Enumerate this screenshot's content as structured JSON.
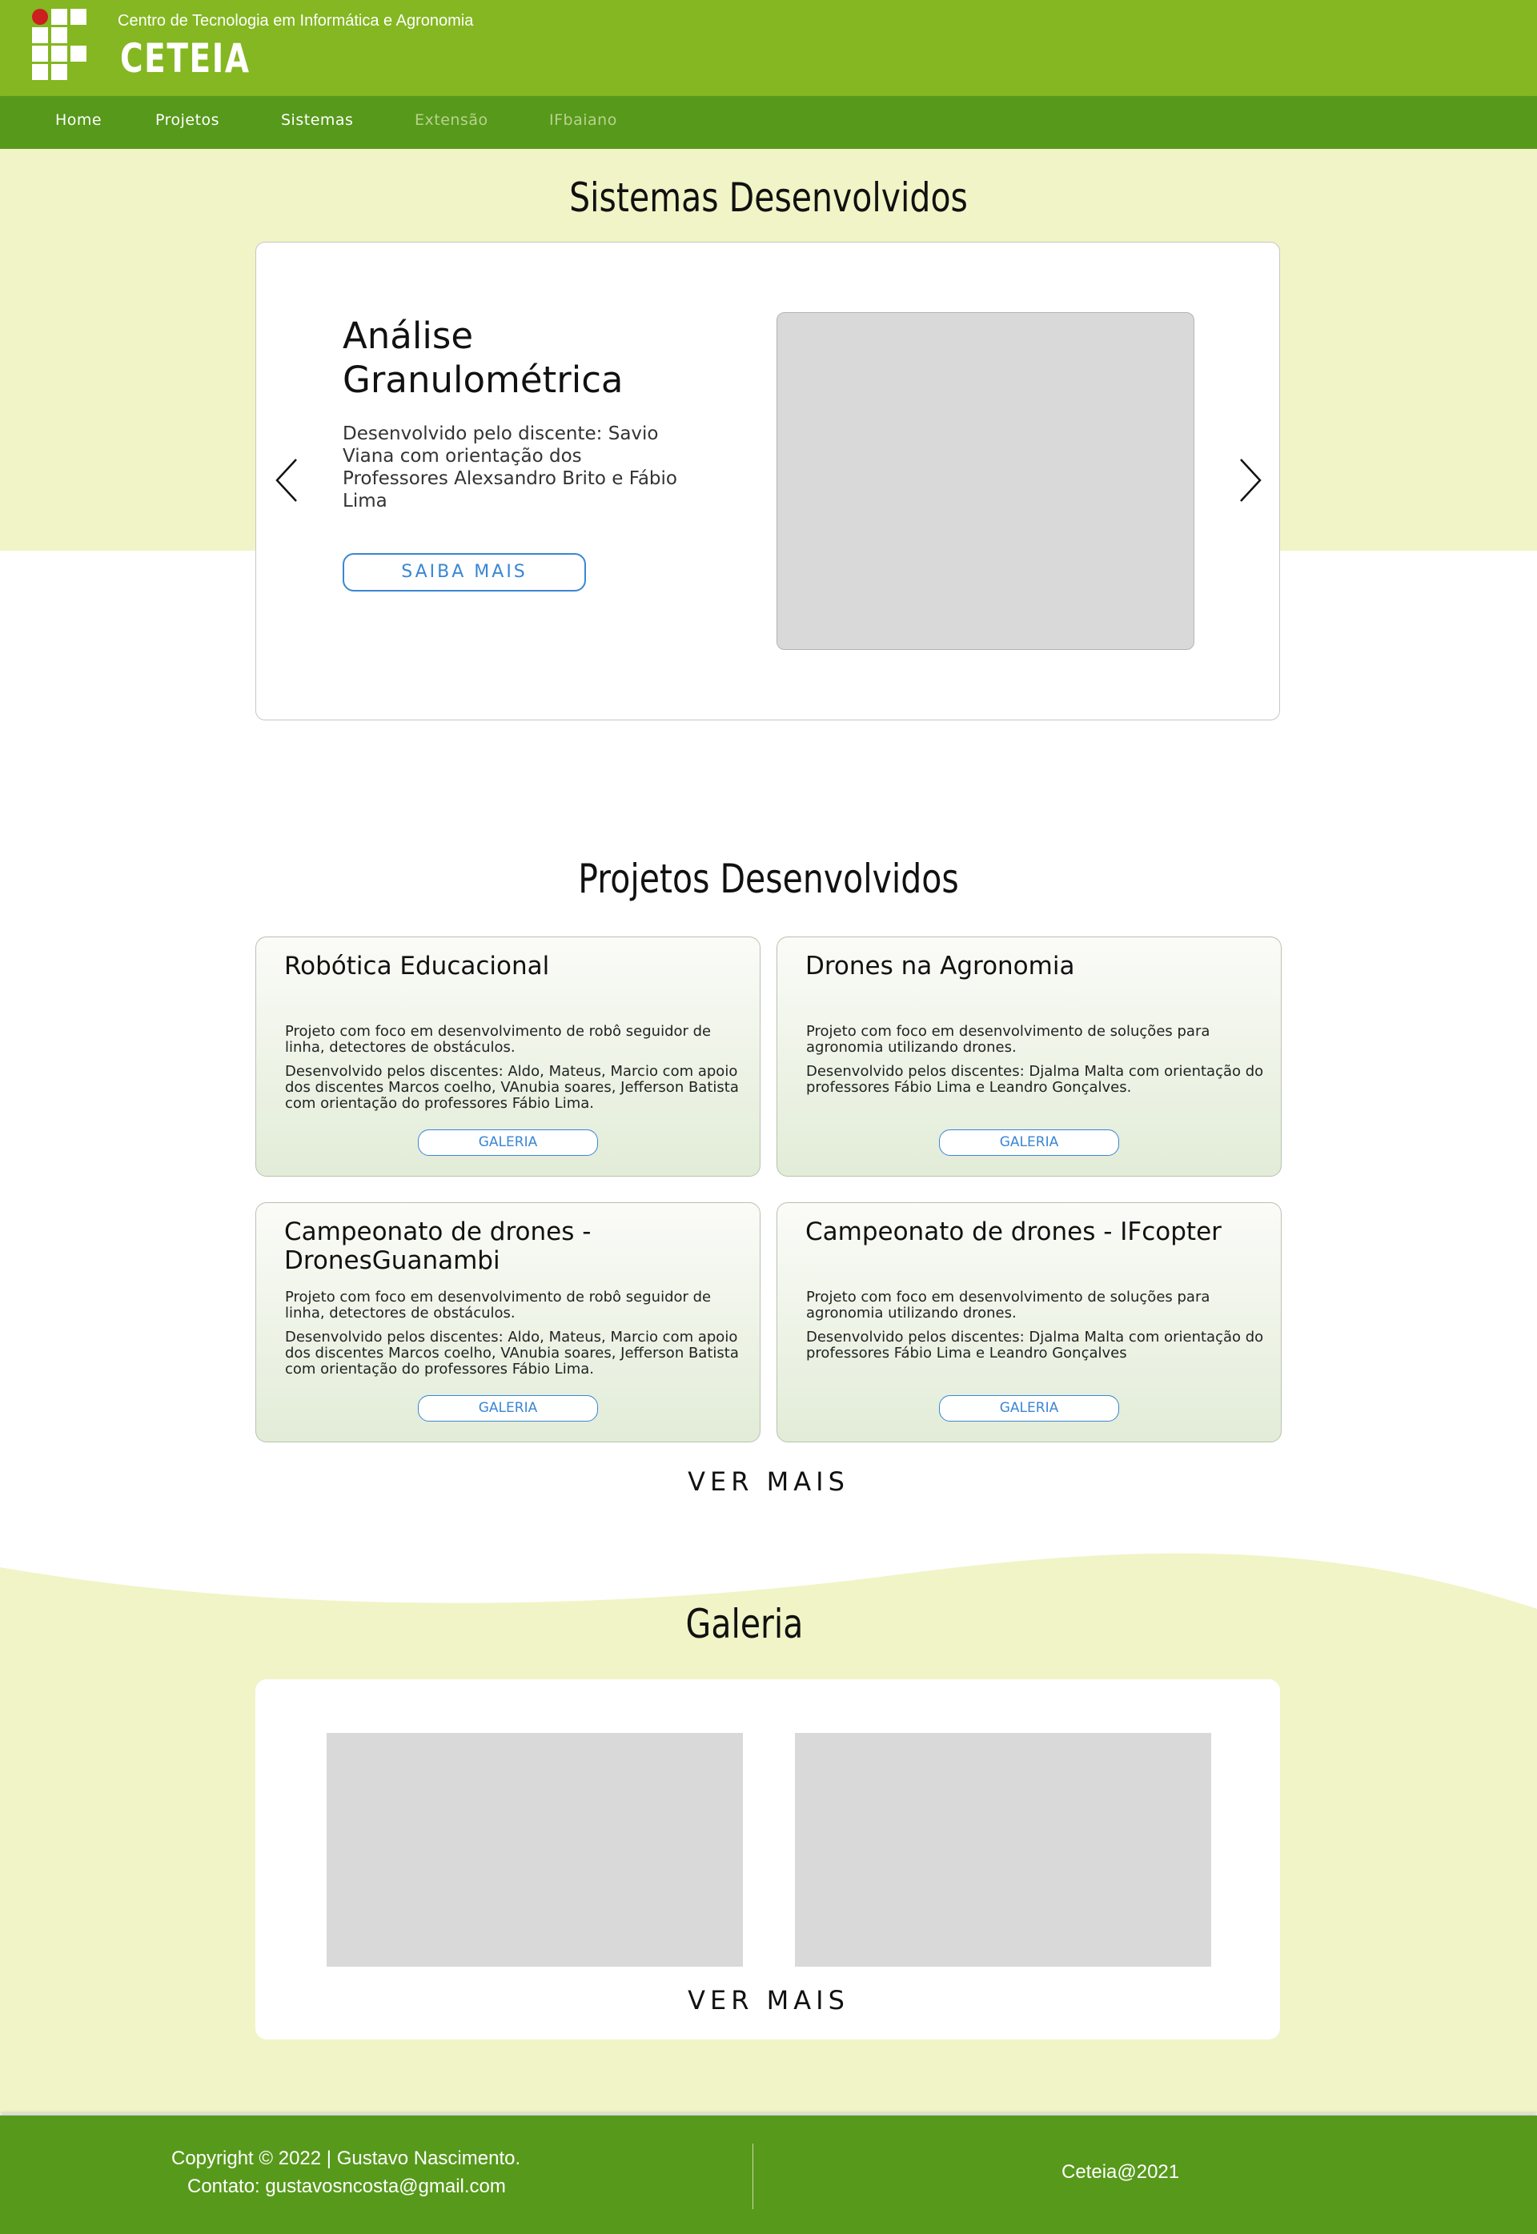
{
  "header": {
    "subtitle": "Centro de Tecnologia em Informática e Agronomia",
    "brand": "CETEIA",
    "logo_icon": "ifbaiano-logo-icon"
  },
  "nav": {
    "items": [
      {
        "label": "Home",
        "state": "normal"
      },
      {
        "label": "Projetos",
        "state": "normal"
      },
      {
        "label": "Sistemas",
        "state": "normal"
      },
      {
        "label": "Extensão",
        "state": "dimmed"
      },
      {
        "label": "IFbaiano",
        "state": "dimmed"
      }
    ]
  },
  "systems": {
    "section_title": "Sistemas Desenvolvidos",
    "slide": {
      "title": "Análise Granulométrica",
      "description": "Desenvolvido pelo discente: Savio Viana com orientação dos Professores Alexsandro Brito e Fábio Lima",
      "button_label": "SAIBA MAIS"
    },
    "prev_icon": "chevron-left-icon",
    "next_icon": "chevron-right-icon"
  },
  "projects": {
    "section_title": "Projetos Desenvolvidos",
    "cards": [
      {
        "title": "Robótica Educacional",
        "text1": "Projeto com foco em desenvolvimento de robô seguidor de linha, detectores de obstáculos.",
        "text2": "Desenvolvido pelos discentes: Aldo, Mateus, Marcio com apoio dos discentes Marcos coelho, VAnubia soares, Jefferson Batista com orientação do professores Fábio Lima.",
        "button_label": "GALERIA"
      },
      {
        "title": "Drones na Agronomia",
        "text1": "Projeto com foco em desenvolvimento de soluções para agronomia utilizando drones.",
        "text2": "Desenvolvido pelos discentes: Djalma Malta com orientação do professores Fábio Lima e Leandro Gonçalves.",
        "button_label": "GALERIA"
      },
      {
        "title": "Campeonato de drones - DronesGuanambi",
        "text1": "Projeto com foco em desenvolvimento de robô seguidor de linha, detectores de obstáculos.",
        "text2": "Desenvolvido pelos discentes: Aldo, Mateus, Marcio com apoio dos discentes Marcos coelho, VAnubia soares, Jefferson Batista com orientação do professores Fábio Lima.",
        "button_label": "GALERIA"
      },
      {
        "title": "Campeonato de drones - IFcopter",
        "text1": "Projeto com foco em desenvolvimento de soluções para agronomia utilizando drones.",
        "text2": "Desenvolvido pelos discentes: Djalma Malta com orientação do professores Fábio Lima e Leandro Gonçalves",
        "button_label": "GALERIA"
      }
    ],
    "more_label": "VER MAIS"
  },
  "gallery": {
    "section_title": "Galeria",
    "more_label": "VER MAIS"
  },
  "footer": {
    "copyright": "Copyright © 2022 | Gustavo Nascimento.",
    "contact": "Contato: gustavosncosta@gmail.com",
    "right_text": "Ceteia@2021"
  },
  "colors": {
    "header_green": "#84b721",
    "nav_green": "#57991b",
    "section_tint": "#f1f4c6",
    "accent_blue": "#3a86d4"
  }
}
